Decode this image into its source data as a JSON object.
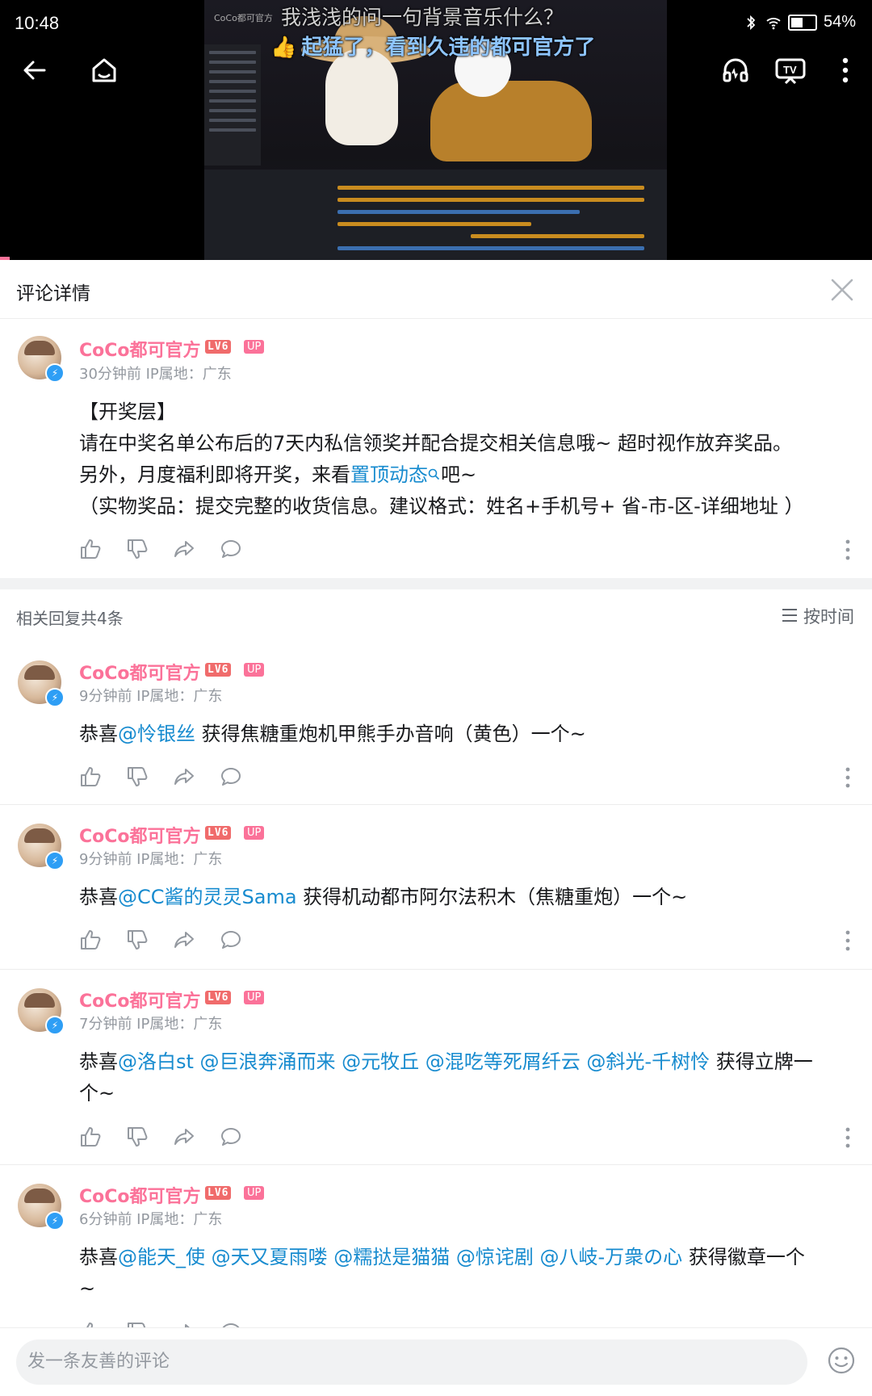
{
  "status_bar": {
    "time": "10:48",
    "battery": "54%"
  },
  "video": {
    "watermark": "CoCo都可官方",
    "danmaku": [
      "我浅浅的问一句背景音乐什么？",
      "起猛了，看到久违的都可官方了"
    ]
  },
  "panel": {
    "title": "评论详情"
  },
  "main_comment": {
    "user": "CoCo都可官方",
    "level": "LV6",
    "up_badge": "UP",
    "meta": "30分钟前  IP属地：广东",
    "line1": "【开奖层】",
    "line2": "请在中奖名单公布后的7天内私信领奖并配合提交相关信息哦~ 超时视作放弃奖品。",
    "line3_pre": "另外，月度福利即将开奖，来看",
    "line3_link": "置顶动态",
    "line3_post": "吧~",
    "line4": "（实物奖品：提交完整的收货信息。建议格式：姓名+手机号+ 省-市-区-详细地址 ）"
  },
  "replies_header": {
    "count_label": "相关回复共4条",
    "sort_label": "按时间"
  },
  "replies": [
    {
      "user": "CoCo都可官方",
      "level": "LV6",
      "up_badge": "UP",
      "meta": "9分钟前  IP属地：广东",
      "pre": "恭喜",
      "mentions": "@怜银丝",
      "post": " 获得焦糖重炮机甲熊手办音响（黄色）一个~"
    },
    {
      "user": "CoCo都可官方",
      "level": "LV6",
      "up_badge": "UP",
      "meta": "9分钟前  IP属地：广东",
      "pre": "恭喜",
      "mentions": "@CC酱的灵灵Sama",
      "post": " 获得机动都市阿尔法积木（焦糖重炮）一个~"
    },
    {
      "user": "CoCo都可官方",
      "level": "LV6",
      "up_badge": "UP",
      "meta": "7分钟前  IP属地：广东",
      "pre": "恭喜",
      "mentions": "@洛白st @巨浪奔涌而来 @元牧丘 @混吃等死屑纤云 @斜光-千树怜",
      "post": " 获得立牌一",
      "line2": "个~"
    },
    {
      "user": "CoCo都可官方",
      "level": "LV6",
      "up_badge": "UP",
      "meta": "6分钟前  IP属地：广东",
      "pre": "恭喜",
      "mentions": "@能天_使 @天又夏雨喽 @糯挞是猫猫 @惊诧剧 @八岐-万衆の心",
      "post": " 获得徽章一个",
      "line2": "~"
    }
  ],
  "input": {
    "placeholder": "发一条友善的评论"
  }
}
